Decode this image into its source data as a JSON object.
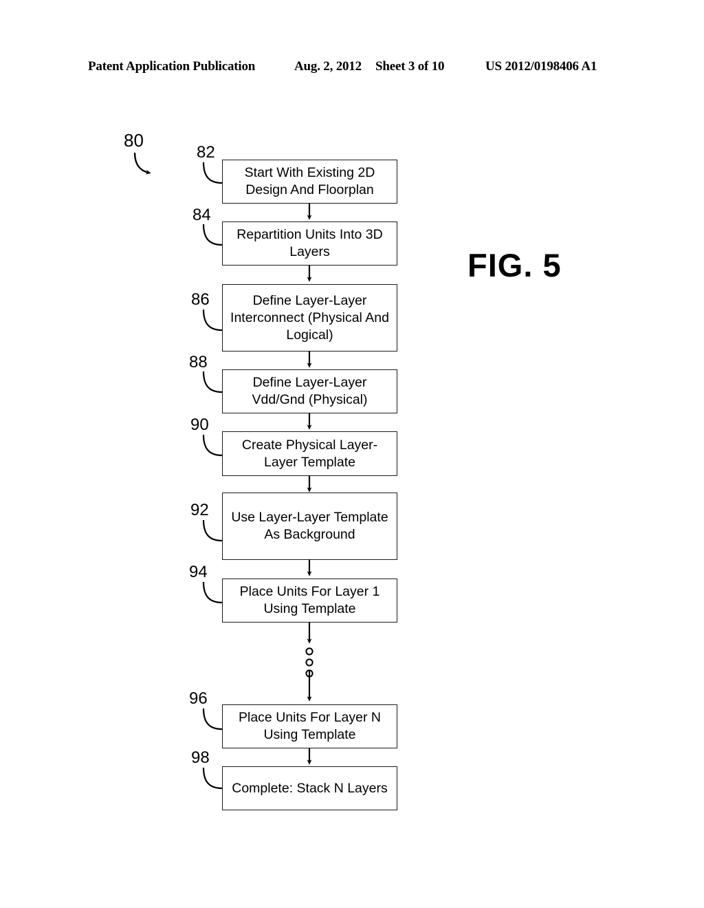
{
  "header": {
    "publication": "Patent Application Publication",
    "date": "Aug. 2, 2012",
    "sheet": "Sheet 3 of 10",
    "publication_number": "US 2012/0198406 A1"
  },
  "figure": {
    "label": "FIG. 5",
    "diagram_ref": "80"
  },
  "flowchart": {
    "type": "flowchart",
    "orientation": "vertical",
    "ellipsis_symbol": "three vertical open circles",
    "steps": [
      {
        "ref": "82",
        "text": "Start With Existing 2D Design And Floorplan",
        "lines": 2
      },
      {
        "ref": "84",
        "text": "Repartition Units Into 3D Layers",
        "lines": 2
      },
      {
        "ref": "86",
        "text": "Define Layer-Layer Interconnect (Physical And Logical)",
        "lines": 3
      },
      {
        "ref": "88",
        "text": "Define Layer-Layer Vdd/Gnd (Physical)",
        "lines": 2
      },
      {
        "ref": "90",
        "text": "Create Physical Layer-Layer Template",
        "lines": 2
      },
      {
        "ref": "92",
        "text": "Use Layer-Layer Template As Background",
        "lines": 3
      },
      {
        "ref": "94",
        "text": "Place Units For Layer 1 Using Template",
        "lines": 2
      },
      {
        "ref": "96",
        "text": "Place Units For Layer N Using Template",
        "lines": 2
      },
      {
        "ref": "98",
        "text": "Complete:  Stack N Layers",
        "lines": 2
      }
    ]
  },
  "colors": {
    "ink": "#000000",
    "paper": "#ffffff"
  }
}
